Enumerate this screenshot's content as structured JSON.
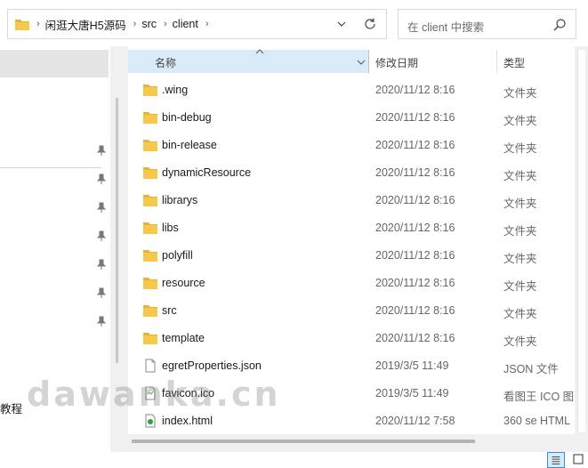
{
  "address": {
    "crumbs": [
      "闲逛大唐H5源码",
      "src",
      "client"
    ],
    "separator": "›"
  },
  "search": {
    "placeholder": "在 client 中搜索"
  },
  "nav": {
    "partial_label": "教程"
  },
  "columns": {
    "name": "名称",
    "date": "修改日期",
    "type": "类型"
  },
  "files": [
    {
      "name": ".wing",
      "date": "2020/11/12 8:16",
      "type": "文件夹",
      "icon": "folder-icon"
    },
    {
      "name": "bin-debug",
      "date": "2020/11/12 8:16",
      "type": "文件夹",
      "icon": "folder-icon"
    },
    {
      "name": "bin-release",
      "date": "2020/11/12 8:16",
      "type": "文件夹",
      "icon": "folder-icon"
    },
    {
      "name": "dynamicResource",
      "date": "2020/11/12 8:16",
      "type": "文件夹",
      "icon": "folder-icon"
    },
    {
      "name": "librarys",
      "date": "2020/11/12 8:16",
      "type": "文件夹",
      "icon": "folder-icon"
    },
    {
      "name": "libs",
      "date": "2020/11/12 8:16",
      "type": "文件夹",
      "icon": "folder-icon"
    },
    {
      "name": "polyfill",
      "date": "2020/11/12 8:16",
      "type": "文件夹",
      "icon": "folder-icon"
    },
    {
      "name": "resource",
      "date": "2020/11/12 8:16",
      "type": "文件夹",
      "icon": "folder-icon"
    },
    {
      "name": "src",
      "date": "2020/11/12 8:16",
      "type": "文件夹",
      "icon": "folder-icon"
    },
    {
      "name": "template",
      "date": "2020/11/12 8:16",
      "type": "文件夹",
      "icon": "folder-icon"
    },
    {
      "name": "egretProperties.json",
      "date": "2019/3/5 11:49",
      "type": "JSON 文件",
      "icon": "json-file-icon"
    },
    {
      "name": "favicon.ico",
      "date": "2019/3/5 11:49",
      "type": "看图王 ICO 图",
      "icon": "ico-file-icon"
    },
    {
      "name": "index.html",
      "date": "2020/11/12 7:58",
      "type": "360 se HTML",
      "icon": "html-file-icon"
    }
  ],
  "watermark": "dawanka.cn",
  "colors": {
    "folder": "#f7c94b",
    "selection": "#d9ebf9",
    "accent": "#3c8fd6"
  }
}
